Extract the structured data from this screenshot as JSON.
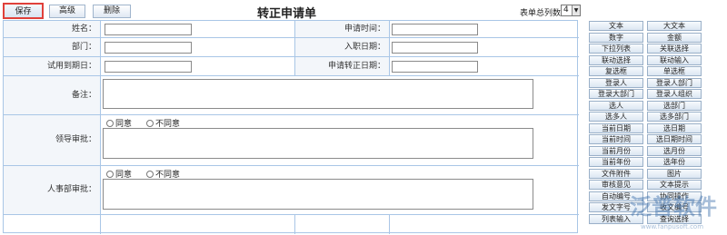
{
  "toolbar": {
    "save": "保存",
    "advanced": "高级",
    "delete": "删除"
  },
  "form_title": "转正申请单",
  "columns_label": "表单总列数：",
  "columns_value": "4",
  "form": {
    "name_label": "姓名：",
    "apply_time_label": "申请时间：",
    "dept_label": "部门：",
    "entry_date_label": "入职日期：",
    "probation_end_label": "试用到期日：",
    "apply_regular_date_label": "申请转正日期：",
    "remark_label": "备注：",
    "leader_label": "领导审批：",
    "hr_label": "人事部审批：",
    "agree": "同意",
    "disagree": "不同意"
  },
  "panel_buttons": [
    [
      "文本",
      "大文本"
    ],
    [
      "数字",
      "金额"
    ],
    [
      "下拉列表",
      "关联选择"
    ],
    [
      "联动选择",
      "联动输入"
    ],
    [
      "复选框",
      "单选框"
    ],
    [
      "登录人",
      "登录人部门"
    ],
    [
      "登录大部门",
      "登录人组织"
    ],
    [
      "选人",
      "选部门"
    ],
    [
      "选多人",
      "选多部门"
    ],
    [
      "当前日期",
      "选日期"
    ],
    [
      "当前时间",
      "选日期时间"
    ],
    [
      "当前月份",
      "选月份"
    ],
    [
      "当前年份",
      "选年份"
    ],
    [
      "文件附件",
      "图片"
    ],
    [
      "审核意见",
      "文本提示"
    ],
    [
      "自动编号",
      "协同操作"
    ],
    [
      "发文字号",
      "收文编号"
    ],
    [
      "列表输入",
      "查询选择"
    ]
  ],
  "watermark": "泛普软件",
  "watermark_url": "www.fanpusoft.com"
}
